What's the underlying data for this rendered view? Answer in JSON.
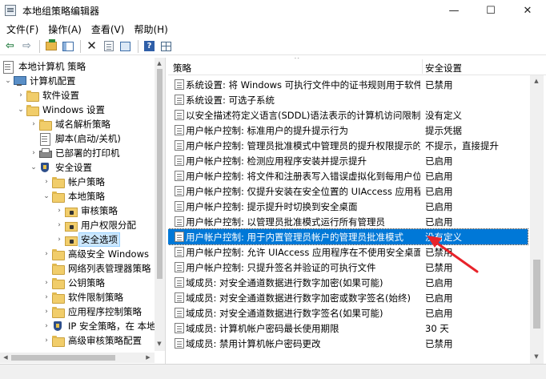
{
  "window": {
    "title": "本地组策略编辑器",
    "minimize_glyph": "—",
    "maximize_glyph": "☐",
    "close_glyph": "✕"
  },
  "menu": [
    "文件(F)",
    "操作(A)",
    "查看(V)",
    "帮助(H)"
  ],
  "toolbar": {
    "icons": [
      "back-icon",
      "forward-icon",
      "up-folder-icon",
      "show-hide-tree-icon",
      "delete-icon",
      "properties-icon",
      "export-list-icon",
      "help-icon",
      "filter-icon"
    ],
    "help_glyph": "?"
  },
  "tree": {
    "items": [
      {
        "label": "本地计算机 策略",
        "icon": "policy-icon",
        "expander": ""
      },
      {
        "label": "计算机配置",
        "icon": "computer-icon",
        "expander": "⌄"
      },
      {
        "label": "软件设置",
        "icon": "folder-icon",
        "expander": "›"
      },
      {
        "label": "Windows 设置",
        "icon": "folder-icon",
        "expander": "⌄"
      },
      {
        "label": "域名解析策略",
        "icon": "folder-icon",
        "expander": "›"
      },
      {
        "label": "脚本(启动/关机)",
        "icon": "script-icon",
        "expander": ""
      },
      {
        "label": "已部署的打印机",
        "icon": "printer-icon",
        "expander": "›"
      },
      {
        "label": "安全设置",
        "icon": "shield-icon",
        "expander": "⌄"
      },
      {
        "label": "帐户策略",
        "icon": "folder-icon",
        "expander": "›"
      },
      {
        "label": "本地策略",
        "icon": "folder-icon",
        "expander": "⌄"
      },
      {
        "label": "审核策略",
        "icon": "lock-folder-icon",
        "expander": "›"
      },
      {
        "label": "用户权限分配",
        "icon": "lock-folder-icon",
        "expander": "›"
      },
      {
        "label": "安全选项",
        "icon": "lock-folder-icon",
        "expander": "›"
      },
      {
        "label": "高级安全 Windows",
        "icon": "folder-icon",
        "expander": "›"
      },
      {
        "label": "网络列表管理器策略",
        "icon": "folder-icon",
        "expander": ""
      },
      {
        "label": "公钥策略",
        "icon": "folder-icon",
        "expander": "›"
      },
      {
        "label": "软件限制策略",
        "icon": "folder-icon",
        "expander": "›"
      },
      {
        "label": "应用程序控制策略",
        "icon": "folder-icon",
        "expander": "›"
      },
      {
        "label": "IP 安全策略，在 本地",
        "icon": "ipsec-icon",
        "expander": "›"
      },
      {
        "label": "高级审核策略配置",
        "icon": "folder-icon",
        "expander": "›"
      }
    ],
    "selected_label": "安全选项"
  },
  "list": {
    "col_policy": "策略",
    "col_setting": "安全设置",
    "rows": [
      {
        "name": "系统设置: 将 Windows 可执行文件中的证书规则用于软件...",
        "setting": "已禁用"
      },
      {
        "name": "系统设置: 可选子系统",
        "setting": ""
      },
      {
        "name": "以安全描述符定义语言(SDDL)语法表示的计算机访问限制",
        "setting": "没有定义"
      },
      {
        "name": "用户帐户控制: 标准用户的提升提示行为",
        "setting": "提示凭据"
      },
      {
        "name": "用户帐户控制: 管理员批准模式中管理员的提升权限提示的...",
        "setting": "不提示，直接提升"
      },
      {
        "name": "用户帐户控制: 检测应用程序安装并提示提升",
        "setting": "已启用"
      },
      {
        "name": "用户帐户控制: 将文件和注册表写入错误虚拟化到每用户位置",
        "setting": "已启用"
      },
      {
        "name": "用户帐户控制: 仅提升安装在安全位置的 UIAccess 应用程序",
        "setting": "已启用"
      },
      {
        "name": "用户帐户控制: 提示提升时切换到安全桌面",
        "setting": "已启用"
      },
      {
        "name": "用户帐户控制: 以管理员批准模式运行所有管理员",
        "setting": "已启用"
      },
      {
        "name": "用户帐户控制: 用于内置管理员帐户的管理员批准模式",
        "setting": "没有定义"
      },
      {
        "name": "用户帐户控制: 允许 UIAccess 应用程序在不使用安全桌面...",
        "setting": "已禁用"
      },
      {
        "name": "用户帐户控制: 只提升签名并验证的可执行文件",
        "setting": "已禁用"
      },
      {
        "name": "域成员: 对安全通道数据进行数字加密(如果可能)",
        "setting": "已启用"
      },
      {
        "name": "域成员: 对安全通道数据进行数字加密或数字签名(始终)",
        "setting": "已启用"
      },
      {
        "name": "域成员: 对安全通道数据进行数字签名(如果可能)",
        "setting": "已启用"
      },
      {
        "name": "域成员: 计算机帐户密码最长使用期限",
        "setting": "30 天"
      },
      {
        "name": "域成员: 禁用计算机帐户密码更改",
        "setting": "已禁用"
      }
    ],
    "selected_row": "用户帐户控制: 用于内置管理员帐户的管理员批准模式"
  },
  "colors": {
    "selection_blue": "#0078d7",
    "tree_selection": "#cce8ff",
    "annotation_arrow": "#e8232a"
  }
}
